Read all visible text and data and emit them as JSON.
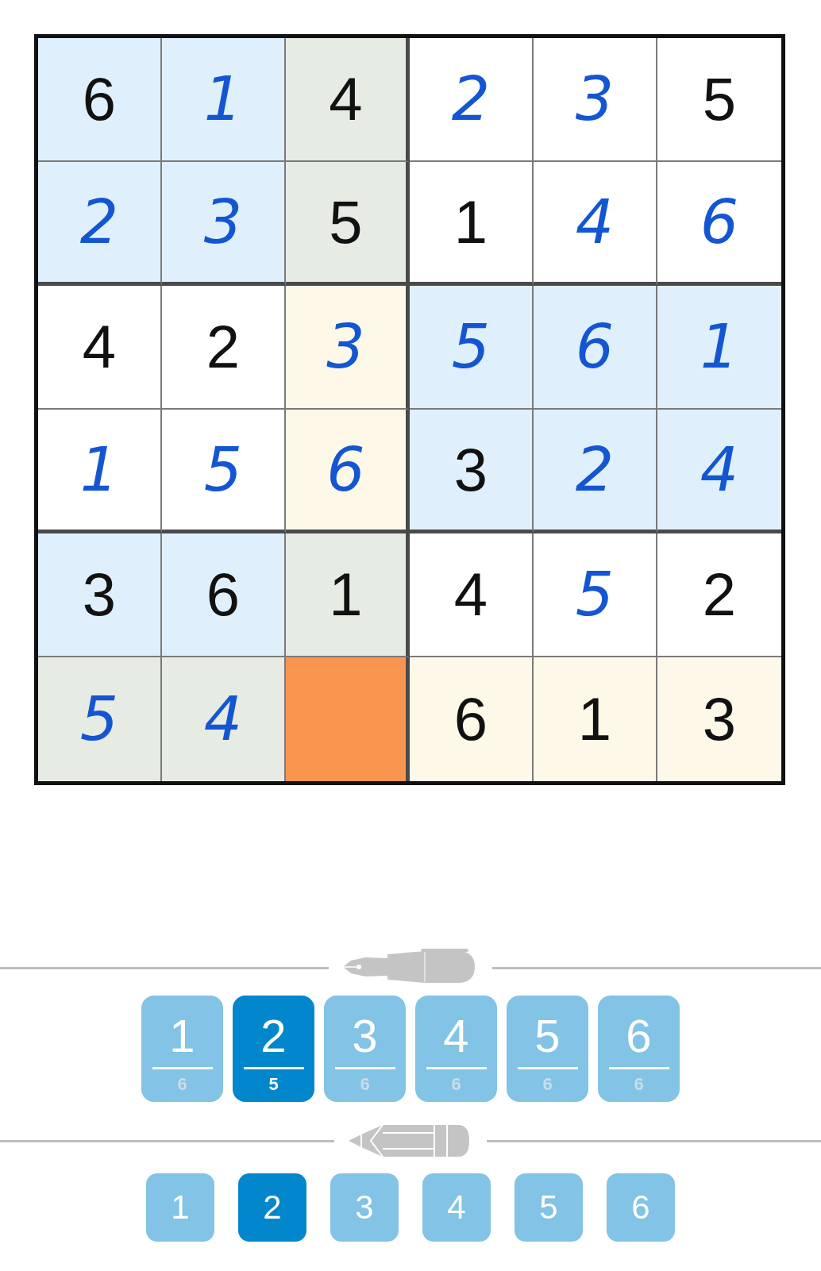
{
  "grid": {
    "rows": [
      [
        {
          "value": "6",
          "kind": "given",
          "color": "#dff0fc"
        },
        {
          "value": "1",
          "kind": "entry",
          "color": "#dff0fc"
        },
        {
          "value": "4",
          "kind": "given",
          "color": "#e6ebe4"
        },
        {
          "value": "2",
          "kind": "entry",
          "color": "#ffffff"
        },
        {
          "value": "3",
          "kind": "entry",
          "color": "#ffffff"
        },
        {
          "value": "5",
          "kind": "given",
          "color": "#ffffff"
        }
      ],
      [
        {
          "value": "2",
          "kind": "entry",
          "color": "#dff0fc"
        },
        {
          "value": "3",
          "kind": "entry",
          "color": "#dff0fc"
        },
        {
          "value": "5",
          "kind": "given",
          "color": "#e6ebe4"
        },
        {
          "value": "1",
          "kind": "given",
          "color": "#ffffff"
        },
        {
          "value": "4",
          "kind": "entry",
          "color": "#ffffff"
        },
        {
          "value": "6",
          "kind": "entry",
          "color": "#ffffff"
        }
      ],
      [
        {
          "value": "4",
          "kind": "given",
          "color": "#ffffff"
        },
        {
          "value": "2",
          "kind": "given",
          "color": "#ffffff"
        },
        {
          "value": "3",
          "kind": "entry",
          "color": "#fdf8e7"
        },
        {
          "value": "5",
          "kind": "entry",
          "color": "#dff0fc"
        },
        {
          "value": "6",
          "kind": "entry",
          "color": "#dff0fc"
        },
        {
          "value": "1",
          "kind": "entry",
          "color": "#dff0fc"
        }
      ],
      [
        {
          "value": "1",
          "kind": "entry",
          "color": "#ffffff"
        },
        {
          "value": "5",
          "kind": "entry",
          "color": "#ffffff"
        },
        {
          "value": "6",
          "kind": "entry",
          "color": "#fdf8e7"
        },
        {
          "value": "3",
          "kind": "given",
          "color": "#dff0fc"
        },
        {
          "value": "2",
          "kind": "entry",
          "color": "#dff0fc"
        },
        {
          "value": "4",
          "kind": "entry",
          "color": "#dff0fc"
        }
      ],
      [
        {
          "value": "3",
          "kind": "given",
          "color": "#dff0fc"
        },
        {
          "value": "6",
          "kind": "given",
          "color": "#dff0fc"
        },
        {
          "value": "1",
          "kind": "given",
          "color": "#e6ebe4"
        },
        {
          "value": "4",
          "kind": "given",
          "color": "#ffffff"
        },
        {
          "value": "5",
          "kind": "entry",
          "color": "#ffffff"
        },
        {
          "value": "2",
          "kind": "given",
          "color": "#ffffff"
        }
      ],
      [
        {
          "value": "5",
          "kind": "entry",
          "color": "#e6ebe4"
        },
        {
          "value": "4",
          "kind": "entry",
          "color": "#e6ebe4"
        },
        {
          "color": "#f9954f"
        },
        {
          "value": "6",
          "kind": "given",
          "color": "#fdf8e7"
        },
        {
          "value": "1",
          "kind": "given",
          "color": "#fdf8e7"
        },
        {
          "value": "3",
          "kind": "given",
          "color": "#fdf8e7"
        }
      ]
    ]
  },
  "pen_buttons": [
    {
      "label": "1",
      "count": "6",
      "selected": false
    },
    {
      "label": "2",
      "count": "5",
      "selected": true
    },
    {
      "label": "3",
      "count": "6",
      "selected": false
    },
    {
      "label": "4",
      "count": "6",
      "selected": false
    },
    {
      "label": "5",
      "count": "6",
      "selected": false
    },
    {
      "label": "6",
      "count": "6",
      "selected": false
    }
  ],
  "pencil_buttons": [
    {
      "label": "1",
      "selected": false
    },
    {
      "label": "2",
      "selected": true
    },
    {
      "label": "3",
      "selected": false
    },
    {
      "label": "4",
      "selected": false
    },
    {
      "label": "5",
      "selected": false
    },
    {
      "label": "6",
      "selected": false
    }
  ]
}
